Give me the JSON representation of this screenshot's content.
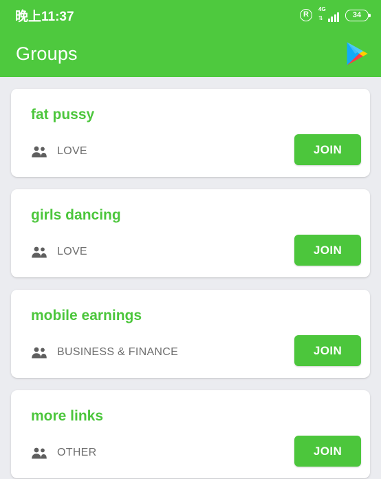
{
  "theme": {
    "header_green": "#4ec93e",
    "accent_green": "#4cc63c",
    "page_background": "#ebecf0",
    "card_background": "#ffffff",
    "category_text": "#6e6e6e"
  },
  "statusbar": {
    "time": "晚上11:37",
    "roaming_label": "R",
    "network_type": "4G",
    "data_arrows": "⇅",
    "battery_level": "34"
  },
  "header": {
    "title": "Groups",
    "action_icon": "play-store-icon"
  },
  "groups": [
    {
      "name": "fat pussy",
      "category": "LOVE",
      "members_icon": "people-icon",
      "join_label": "JOIN"
    },
    {
      "name": "girls dancing",
      "category": "LOVE",
      "members_icon": "people-icon",
      "join_label": "JOIN"
    },
    {
      "name": "mobile earnings",
      "category": "BUSINESS & FINANCE",
      "members_icon": "people-icon",
      "join_label": "JOIN"
    },
    {
      "name": "more links",
      "category": "OTHER",
      "members_icon": "people-icon",
      "join_label": "JOIN"
    }
  ]
}
